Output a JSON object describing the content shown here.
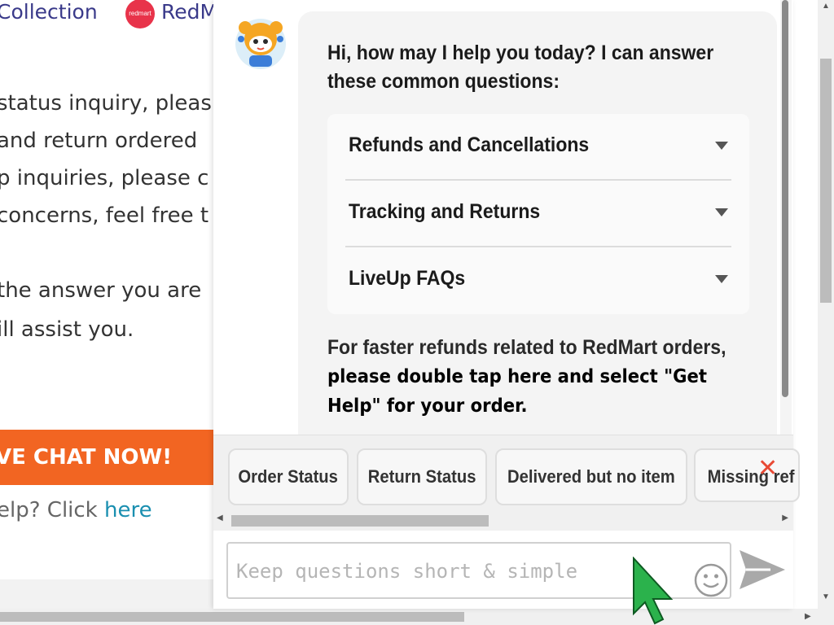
{
  "background_page": {
    "nav": {
      "collection": "Collection",
      "redmart_logo": "redmart",
      "redmart": "RedM"
    },
    "lines": [
      "status inquiry, pleas",
      "and return ordered",
      "p inquiries, please c",
      "concerns, feel free t",
      "the answer you are",
      "ill assist you."
    ],
    "cta": "VE CHAT NOW!",
    "help_prefix": "elp? Click ",
    "help_link": "here"
  },
  "chat": {
    "greeting": "Hi, how may I help you today? I can answer these common questions:",
    "faq": [
      {
        "label": "Refunds and Cancellations"
      },
      {
        "label": "Tracking and Returns"
      },
      {
        "label": "LiveUp FAQs"
      }
    ],
    "faster_plain": "For faster refunds related to RedMart orders,",
    "faster_bold": "please double tap here and select \"Get Help\" for your order.",
    "quick_replies": [
      {
        "label": "Order Status"
      },
      {
        "label": "Return Status"
      },
      {
        "label": "Delivered but no item"
      },
      {
        "label": "Missing ref"
      }
    ],
    "input_placeholder": "Keep questions short & simple"
  },
  "colors": {
    "cta_orange": "#f26522",
    "link_teal": "#1a8fb0",
    "close_red": "#e84a35",
    "cursor_green": "#2bb24c"
  },
  "icons": [
    "redmart-logo-icon",
    "bot-avatar-icon",
    "caret-down-icon",
    "close-icon",
    "emoji-icon",
    "send-icon",
    "mouse-cursor-icon"
  ]
}
